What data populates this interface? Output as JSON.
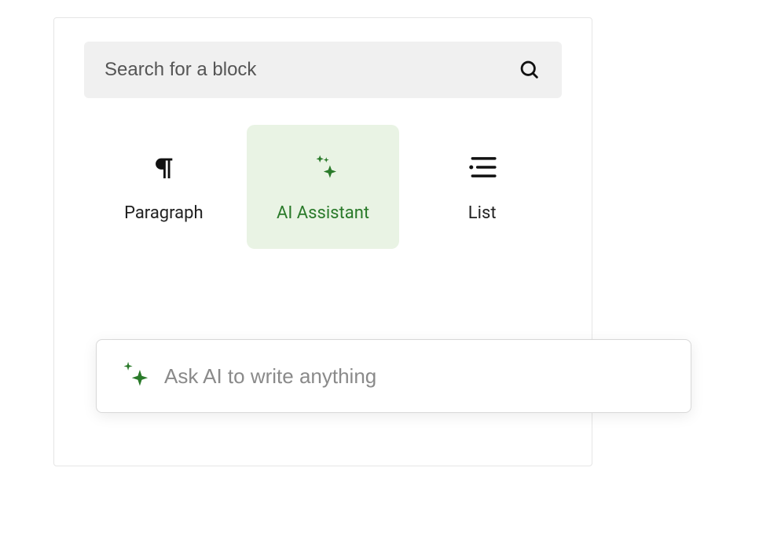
{
  "search": {
    "placeholder": "Search for a block"
  },
  "blocks": [
    {
      "label": "Paragraph"
    },
    {
      "label": "AI Assistant"
    },
    {
      "label": "List"
    }
  ],
  "ai_input": {
    "placeholder": "Ask AI to write anything"
  },
  "colors": {
    "accent_green": "#2a7a2a",
    "tint_bg": "#e9f3e4"
  }
}
